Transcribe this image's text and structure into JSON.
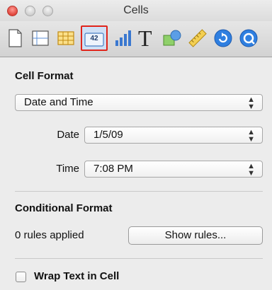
{
  "window": {
    "title": "Cells"
  },
  "toolbar": {
    "items": [
      {
        "name": "document-inspector",
        "icon": "document-icon"
      },
      {
        "name": "layout-inspector",
        "icon": "layout-icon"
      },
      {
        "name": "table-inspector",
        "icon": "table-icon"
      },
      {
        "name": "cells-inspector",
        "icon": "cells-icon",
        "label": "42",
        "selected": true
      },
      {
        "name": "chart-inspector",
        "icon": "bar-chart-icon"
      },
      {
        "name": "text-inspector",
        "icon": "text-icon",
        "label": "T"
      },
      {
        "name": "graphic-inspector",
        "icon": "shapes-icon"
      },
      {
        "name": "metrics-inspector",
        "icon": "ruler-icon"
      },
      {
        "name": "hyperlink-inspector",
        "icon": "arrow-circle-icon"
      },
      {
        "name": "quicktime-inspector",
        "icon": "q-circle-icon"
      }
    ]
  },
  "cell_format": {
    "heading": "Cell Format",
    "format_value": "Date and Time",
    "date_label": "Date",
    "date_value": "1/5/09",
    "time_label": "Time",
    "time_value": "7:08 PM"
  },
  "conditional_format": {
    "heading": "Conditional Format",
    "status": "0 rules applied",
    "show_rules_label": "Show rules..."
  },
  "wrap_text": {
    "label": "Wrap Text in Cell",
    "checked": false
  },
  "colors": {
    "selection_outline": "#e0241b",
    "close_button": "#e0453b"
  }
}
